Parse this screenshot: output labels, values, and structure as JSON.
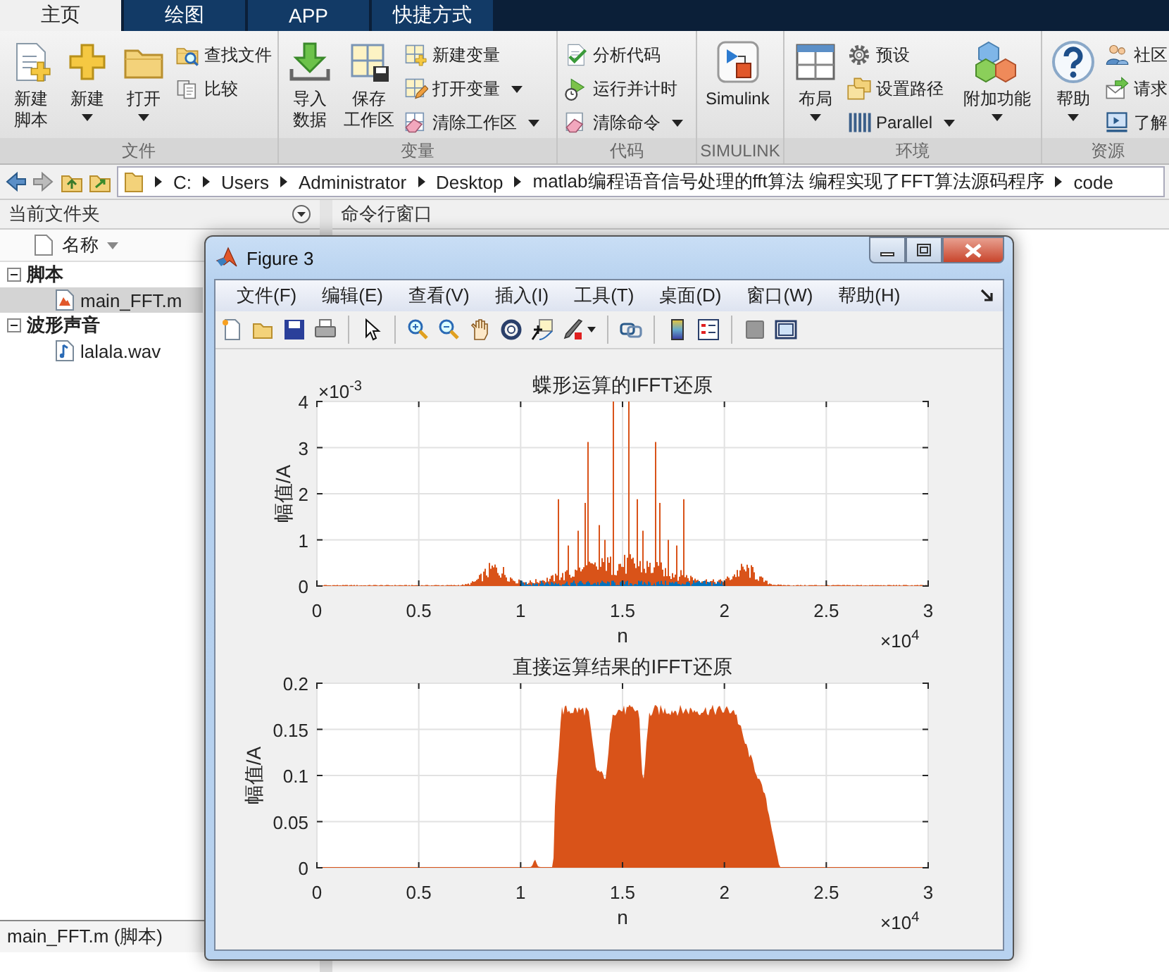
{
  "tabs": [
    {
      "label": "主页",
      "selected": true
    },
    {
      "label": "绘图",
      "selected": false
    },
    {
      "label": "APP",
      "selected": false
    },
    {
      "label": "快捷方式",
      "selected": false
    }
  ],
  "toolstrip": [
    {
      "label": "文件",
      "items": [
        {
          "kind": "large",
          "lines": [
            "新建",
            "脚本"
          ],
          "dropdown": false
        },
        {
          "kind": "large",
          "label": "新建",
          "dropdown": true
        },
        {
          "kind": "large",
          "label": "打开",
          "dropdown": true
        },
        {
          "kind": "small",
          "label": "查找文件",
          "dropdown": false
        },
        {
          "kind": "small",
          "label": "比较",
          "dropdown": false
        }
      ]
    },
    {
      "label": "变量",
      "items": [
        {
          "kind": "large",
          "lines": [
            "导入",
            "数据"
          ],
          "dropdown": false
        },
        {
          "kind": "large",
          "lines": [
            "保存",
            "工作区"
          ],
          "dropdown": false
        },
        {
          "kind": "small",
          "label": "新建变量",
          "dropdown": false
        },
        {
          "kind": "small",
          "label": "打开变量",
          "dropdown": true
        },
        {
          "kind": "small",
          "label": "清除工作区",
          "dropdown": true
        }
      ]
    },
    {
      "label": "代码",
      "items": [
        {
          "kind": "small",
          "label": "分析代码",
          "dropdown": false
        },
        {
          "kind": "small",
          "label": "运行并计时",
          "dropdown": false
        },
        {
          "kind": "small",
          "label": "清除命令",
          "dropdown": true
        }
      ]
    },
    {
      "label": "SIMULINK",
      "items": [
        {
          "kind": "large",
          "label": "Simulink",
          "dropdown": false
        }
      ]
    },
    {
      "label": "环境",
      "items": [
        {
          "kind": "large",
          "label": "布局",
          "dropdown": true
        },
        {
          "kind": "small",
          "label": "预设",
          "dropdown": false
        },
        {
          "kind": "small",
          "label": "设置路径",
          "dropdown": false
        },
        {
          "kind": "small",
          "label": "Parallel",
          "dropdown": true
        },
        {
          "kind": "large",
          "label": "附加功能",
          "dropdown": true
        }
      ]
    },
    {
      "label": "资源",
      "items": [
        {
          "kind": "large",
          "label": "帮助",
          "dropdown": true
        },
        {
          "kind": "small",
          "label": "社区",
          "dropdown": false
        },
        {
          "kind": "small",
          "label": "请求",
          "dropdown": false
        },
        {
          "kind": "small",
          "label": "了解",
          "dropdown": false
        }
      ]
    }
  ],
  "address": {
    "crumbs": [
      "C:",
      "Users",
      "Administrator",
      "Desktop",
      "matlab编程语音信号处理的fft算法 编程实现了FFT算法源码程序",
      "code"
    ]
  },
  "files": {
    "title": "当前文件夹",
    "column": "名称",
    "groups": [
      {
        "label": "脚本",
        "expanded": true,
        "children": [
          {
            "name": "main_FFT.m",
            "kind": "script",
            "selected": true
          }
        ]
      },
      {
        "label": "波形声音",
        "expanded": true,
        "children": [
          {
            "name": "lalala.wav",
            "kind": "audio",
            "selected": false
          }
        ]
      }
    ],
    "details": "main_FFT.m  (脚本)"
  },
  "command_window": {
    "title": "命令行窗口"
  },
  "figure": {
    "title": "Figure 3",
    "menus": [
      "文件(F)",
      "编辑(E)",
      "查看(V)",
      "插入(I)",
      "工具(T)",
      "桌面(D)",
      "窗口(W)",
      "帮助(H)"
    ],
    "plots": [
      {
        "title": "蝶形运算的IFFT还原",
        "y_exponent": "×10$^{-3}$",
        "ylabel": "幅值/A",
        "yticks": [
          "4",
          "3",
          "2",
          "1",
          "0"
        ],
        "xticks": [
          "0",
          "0.5",
          "1",
          "1.5",
          "2",
          "2.5",
          "3"
        ],
        "xlabel": "n",
        "x_exponent": "×10$^{4}$"
      },
      {
        "title": "直接运算结果的IFFT还原",
        "ylabel": "幅值/A",
        "yticks": [
          "0.2",
          "0.15",
          "0.1",
          "0.05",
          "0"
        ],
        "xticks": [
          "0",
          "0.5",
          "1",
          "1.5",
          "2",
          "2.5",
          "3"
        ],
        "xlabel": "n",
        "x_exponent": "×10$^{4}$"
      }
    ]
  }
}
